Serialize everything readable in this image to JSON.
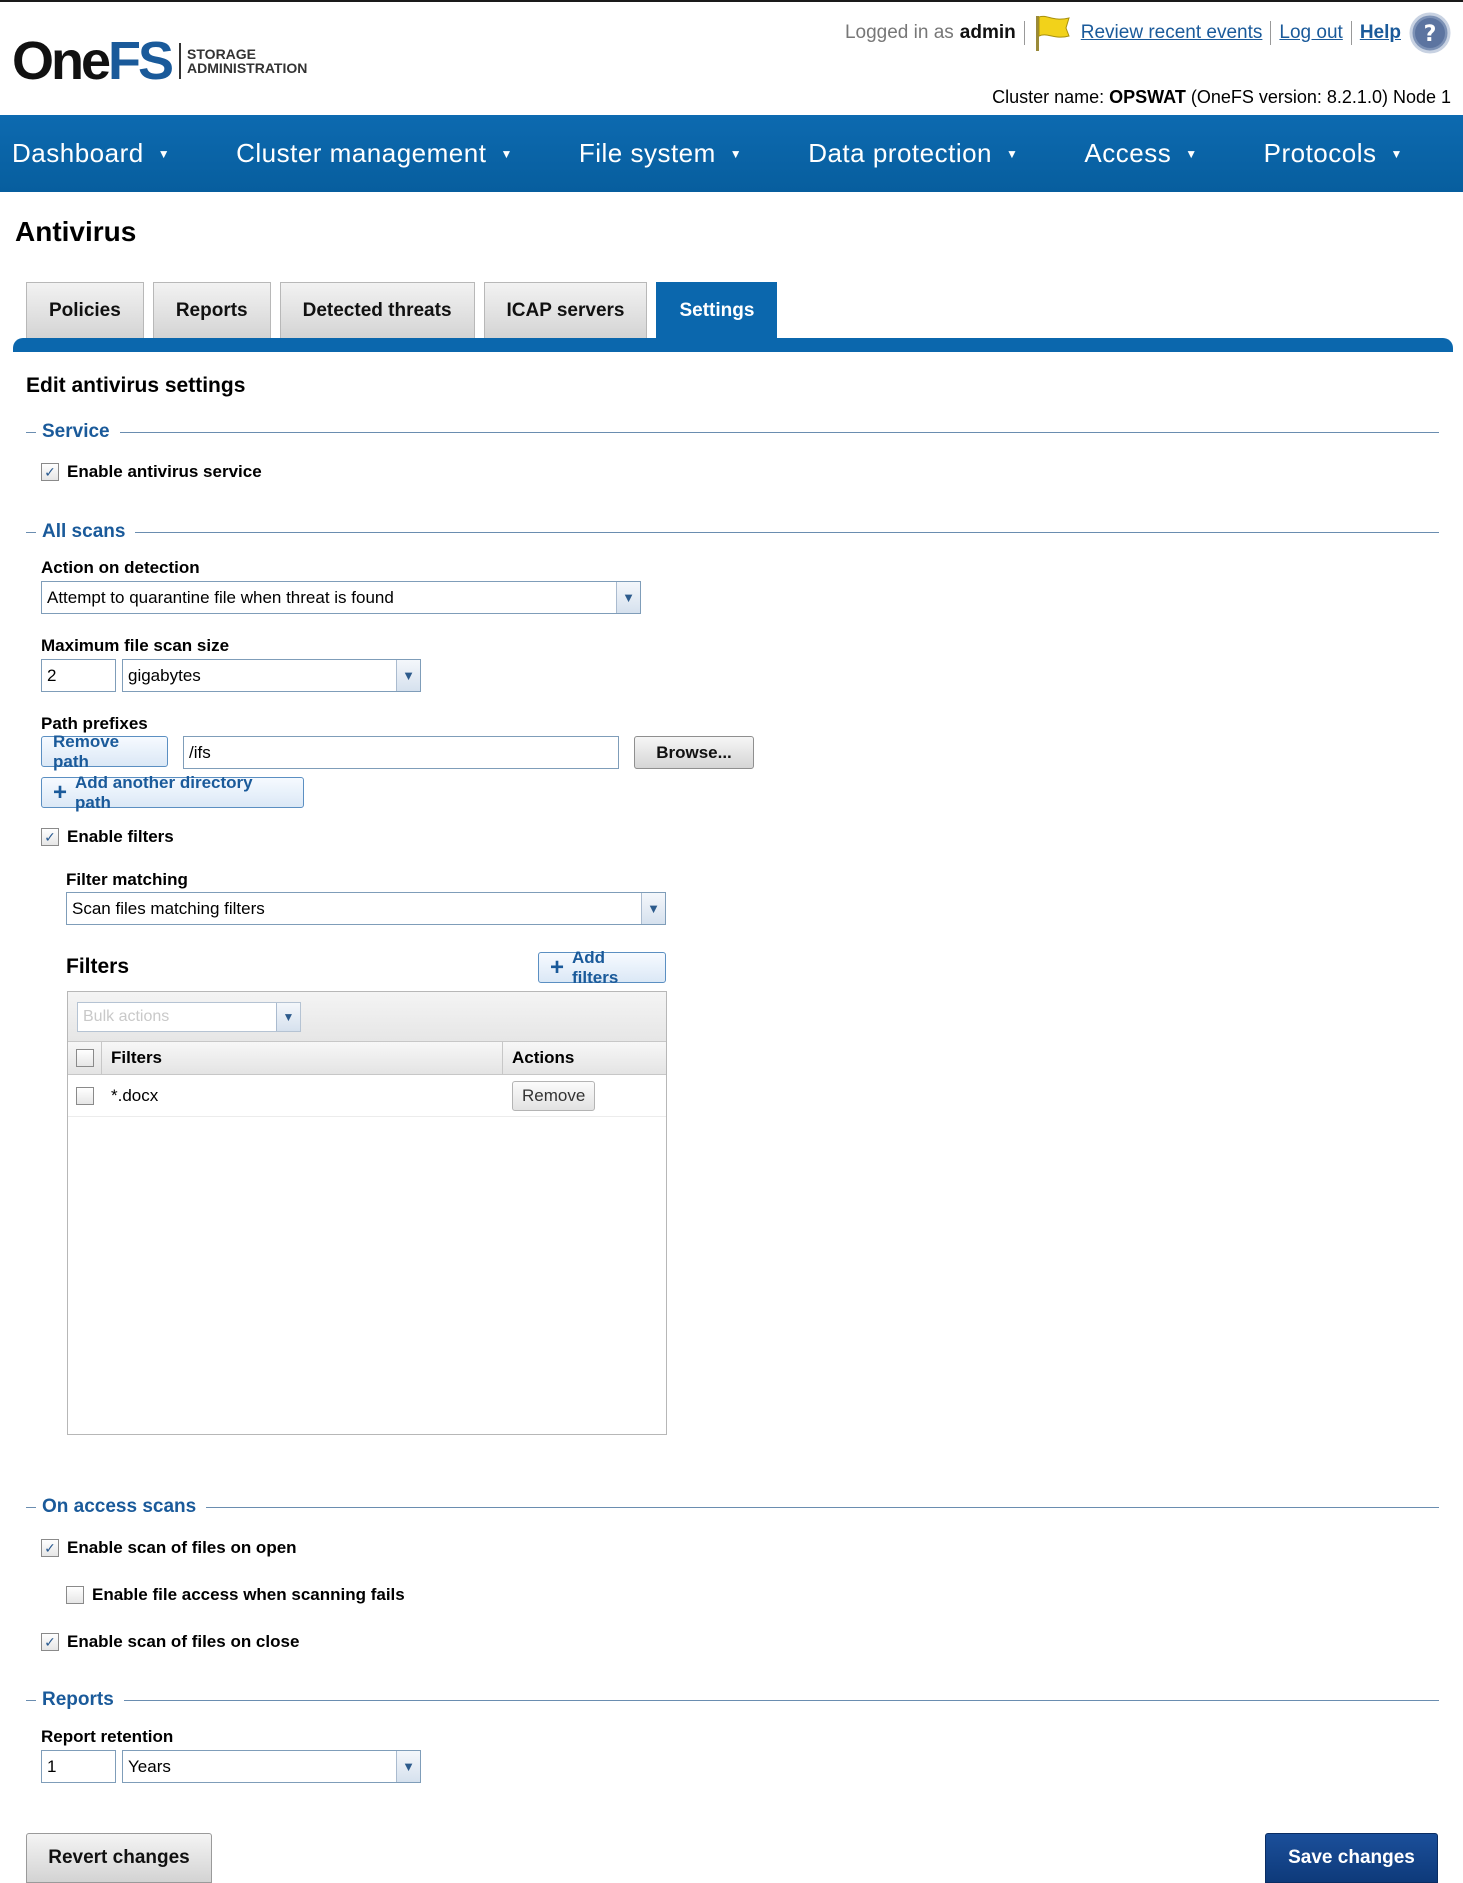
{
  "header": {
    "logo_one": "One",
    "logo_fs": "FS",
    "logo_sub_1": "STORAGE",
    "logo_sub_2": "ADMINISTRATION",
    "logged_in_label": "Logged in as",
    "username": "admin",
    "review_events_link": "Review recent events",
    "logout_link": "Log out",
    "help_link": "Help",
    "cluster_prefix": "Cluster name:",
    "cluster_name": "OPSWAT",
    "cluster_suffix": "(OneFS version: 8.2.1.0) Node 1"
  },
  "nav": {
    "items": [
      {
        "label": "Dashboard"
      },
      {
        "label": "Cluster management"
      },
      {
        "label": "File system"
      },
      {
        "label": "Data protection"
      },
      {
        "label": "Access"
      },
      {
        "label": "Protocols"
      }
    ]
  },
  "page": {
    "title": "Antivirus",
    "tabs": [
      {
        "label": "Policies",
        "active": false
      },
      {
        "label": "Reports",
        "active": false
      },
      {
        "label": "Detected threats",
        "active": false
      },
      {
        "label": "ICAP servers",
        "active": false
      },
      {
        "label": "Settings",
        "active": true
      }
    ],
    "heading": "Edit antivirus settings"
  },
  "service": {
    "legend": "Service",
    "enable_label": "Enable antivirus service",
    "enable_checked": true
  },
  "all_scans": {
    "legend": "All scans",
    "action_label": "Action on detection",
    "action_value": "Attempt to quarantine file when threat is found",
    "max_size_label": "Maximum file scan size",
    "max_size_value": "2",
    "max_size_unit": "gigabytes",
    "path_label": "Path prefixes",
    "remove_path_button": "Remove path",
    "path_value": "/ifs",
    "browse_button": "Browse...",
    "add_path_button": "Add another directory path",
    "enable_filters_label": "Enable filters",
    "enable_filters_checked": true,
    "filter_matching_label": "Filter matching",
    "filter_matching_value": "Scan files matching filters",
    "filters_title": "Filters",
    "add_filters_button": "Add filters",
    "bulk_actions_placeholder": "Bulk actions",
    "table_headers": [
      "Filters",
      "Actions"
    ],
    "rows": [
      {
        "filter": "*.docx",
        "action": "Remove"
      }
    ]
  },
  "on_access": {
    "legend": "On access scans",
    "scan_on_open_label": "Enable scan of files on open",
    "scan_on_open_checked": true,
    "access_on_fail_label": "Enable file access when scanning fails",
    "access_on_fail_checked": false,
    "scan_on_close_label": "Enable scan of files on close",
    "scan_on_close_checked": true
  },
  "reports": {
    "legend": "Reports",
    "retention_label": "Report retention",
    "retention_value": "1",
    "retention_unit": "Years"
  },
  "footer": {
    "revert_button": "Revert changes",
    "save_button": "Save changes"
  },
  "colors": {
    "brand_blue": "#0b67ad",
    "link_blue": "#1a5a9a",
    "save_blue": "#14458a"
  }
}
